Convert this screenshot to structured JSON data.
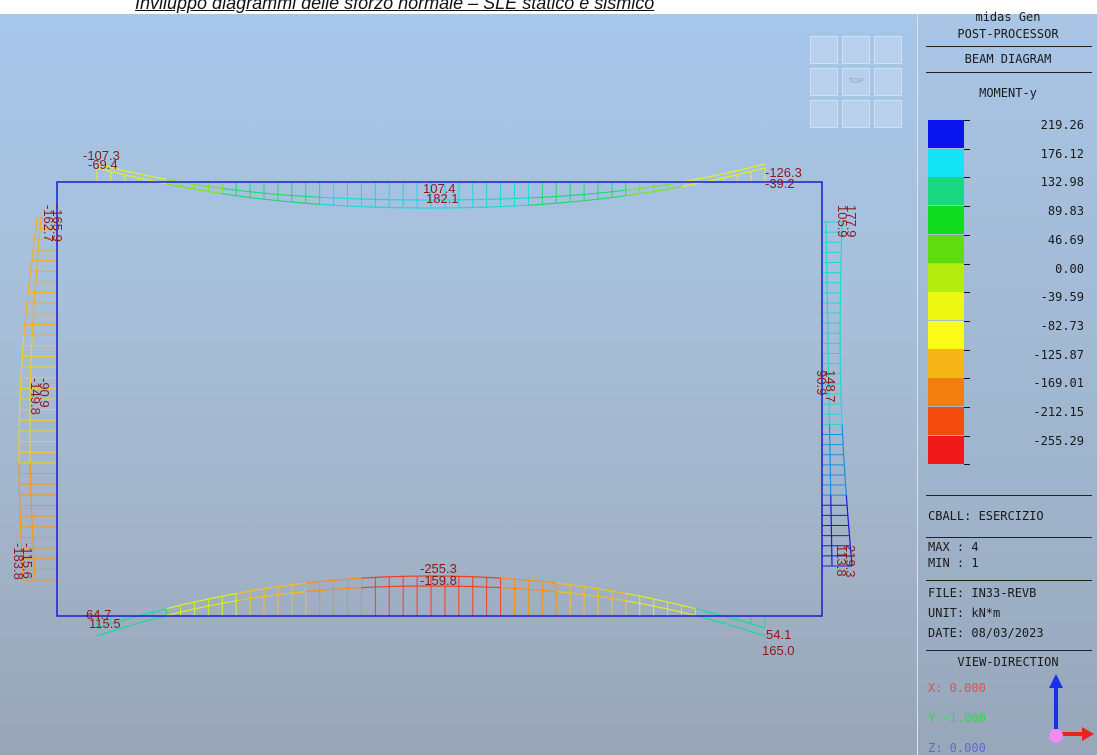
{
  "caption": "Inviluppo diagrammi delle sforzo normale – SLE statico e sismico",
  "cube": {
    "top_label": "TOP"
  },
  "panel": {
    "program": "midas Gen",
    "mode": "POST-PROCESSOR",
    "diagram": "BEAM DIAGRAM",
    "result": "MOMENT-y",
    "legend": [
      {
        "value": "219.26",
        "color": "#0a14ef"
      },
      {
        "value": "176.12",
        "color": "#14e4f4"
      },
      {
        "value": "132.98",
        "color": "#18d884"
      },
      {
        "value": "89.83",
        "color": "#10dc20"
      },
      {
        "value": "46.69",
        "color": "#5fdc10"
      },
      {
        "value": "0.00",
        "color": "#b4ec10"
      },
      {
        "value": "-39.59",
        "color": "#ecf810"
      },
      {
        "value": "-82.73",
        "color": "#fcfc18"
      },
      {
        "value": "-125.87",
        "color": "#f6b618"
      },
      {
        "value": "-169.01",
        "color": "#f47d10"
      },
      {
        "value": "-212.15",
        "color": "#f44c0c"
      },
      {
        "value": "-255.29",
        "color": "#f01818"
      }
    ],
    "cball": "CBALL: ESERCIZIO",
    "max": "MAX : 4",
    "min": "MIN : 1",
    "file": "FILE: IN33-REVB",
    "unit": "UNIT: kN*m",
    "date": "DATE: 08/03/2023",
    "view_direction": "VIEW-DIRECTION",
    "vx": "X: 0.000",
    "vy": "Y:-1.000",
    "vz": "Z: 0.000"
  },
  "labels": {
    "top_left_a": "-107.3",
    "top_left_b": "-69.4",
    "top_mid_a": "107.4",
    "top_mid_b": "182.1",
    "top_right_a": "-126.3",
    "top_right_b": "-39.2",
    "left_top_a": "-162.7",
    "left_top_b": "-165.9",
    "left_mid_a": "-149.8",
    "left_mid_b": "-90.9",
    "left_bot_a": "-183.8",
    "left_bot_b": "-115.6",
    "right_top_a": "105.9",
    "right_top_b": "177.9",
    "right_mid_a": "90.9",
    "right_mid_b": "148.7",
    "right_bot_a": "113.8",
    "right_bot_b": "219.3",
    "bot_mid_a": "-255.3",
    "bot_mid_b": "-159.8",
    "bot_left_a": "64.7",
    "bot_left_b": "115.5",
    "bot_right_a": "54.1",
    "bot_right_b": "165.0"
  }
}
